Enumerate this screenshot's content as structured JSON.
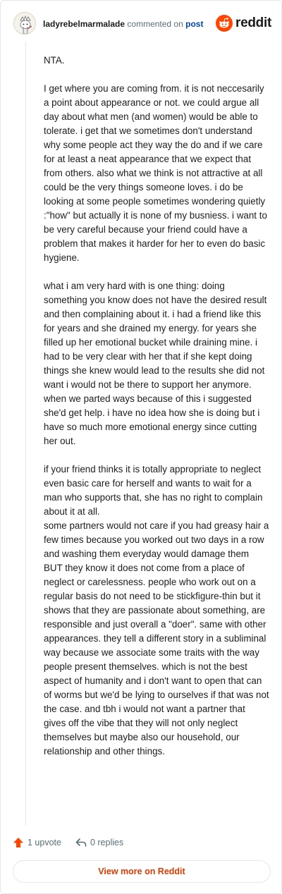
{
  "header": {
    "username": "ladyrebelmarmalade",
    "commented_on_text": "commented on",
    "post_link": "post",
    "brand_name": "reddit"
  },
  "comment": {
    "paragraphs": [
      "NTA.",
      "I get where you are coming from. it is not neccesarily a point about appearance or not. we could argue all day about what men (and women) would be able to tolerate. i get that we sometimes don't understand why some people act they way the do and if we care for at least a neat appearance that we expect that from others. also what we think is not attractive at all could be the very things someone loves. i do be looking at some people sometimes wondering quietly :\"how\" but actually it is none of my busniess. i want to be very careful because your friend could have a problem that makes it harder for her to even do basic hygiene.",
      "what i am very hard with is one thing: doing something you know does not have the desired result and then complaining about it. i had a friend like this for years and she drained my energy. for years she filled up her emotional bucket while draining mine. i had to be very clear with her that if she kept doing things she knew would lead to the results she did not want i would not be there to support her anymore. when we parted ways because of this i suggested she'd get help. i have no idea how she is doing but i have so much more emotional energy since cutting her out.",
      "if your friend thinks it is totally appropriate to neglect even basic care for herself and wants to wait for a man who supports that, she has no right to complain about it at all.\nsome partners would not care if you had greasy hair a few times because you worked out two days in a row and washing them everyday would damage them BUT they know it does not come from a place of neglect or carelessness. people who work out on a regular basis do not need to be stickfigure-thin but it shows that they are passionate about something, are responsible and just overall a \"doer\". same with other appearances. they tell a different story in a subliminal way because we associate some traits with the way people present themselves. which is not the best aspect of humanity and i don't want to open that can of worms but we'd be lying to ourselves if that was not the case. and tbh i would not want a partner that gives off the vibe that they will not only neglect themselves but maybe also our household, our relationship and other things."
    ]
  },
  "actions": {
    "upvote_label": "1 upvote",
    "replies_label": "0 replies"
  },
  "footer": {
    "view_more_label": "View more on Reddit"
  },
  "colors": {
    "accent": "#d93a00",
    "reddit_orange": "#ff4500",
    "link_blue": "#0045ac",
    "muted_text": "#576f76"
  },
  "icons": {
    "avatar": "snoo-avatar",
    "brand": "reddit-logo-icon",
    "upvote": "upvote-arrow-icon",
    "reply": "reply-arrow-icon"
  }
}
